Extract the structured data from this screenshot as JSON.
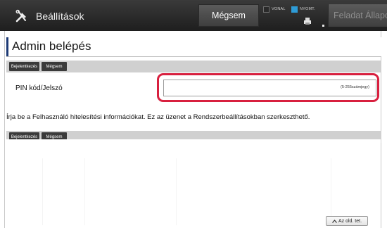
{
  "header": {
    "settings_label": "Beállítások",
    "cancel_label": "Mégsem",
    "status_vonal": "VONAL",
    "status_nyomt": "NYOMT.",
    "job_status_label": "Feladat Állapot",
    "accent_color": "#1d3a75"
  },
  "page": {
    "title": "Admin belépés"
  },
  "action_bar_top": {
    "login_label": "Bejelentkezés",
    "cancel_label": "Mégsem"
  },
  "form": {
    "pin_label": "PIN kód/Jelszó",
    "pin_value": "",
    "pin_hint": "(5-255számjegy)",
    "highlight_color": "#d8203f"
  },
  "info": {
    "message": "Írja be a Felhasználó hitelesítési információkat. Ez az üzenet a Rendszerbeállításokban szerkeszthető."
  },
  "action_bar_bottom": {
    "login_label": "Bejelentkezés",
    "cancel_label": "Mégsem"
  },
  "footer": {
    "page_up_label": "Az old. tet."
  },
  "icons": [
    "settings-tools-icon",
    "printer-icon",
    "chevron-up-icon"
  ]
}
